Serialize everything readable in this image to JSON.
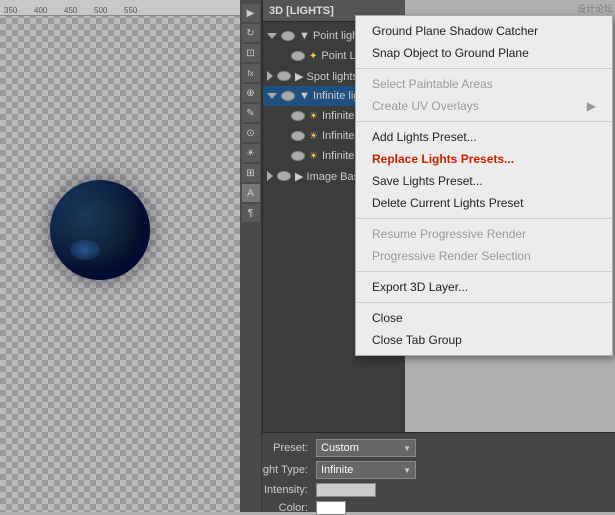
{
  "window": {
    "title": "3D [LIGHTS]"
  },
  "ruler": {
    "marks": [
      "350",
      "400",
      "450",
      "500",
      "550"
    ]
  },
  "panel": {
    "title": "3D [LIGHTS]",
    "sections": [
      {
        "label": "Point lights",
        "items": [
          {
            "label": "Point Li...",
            "indent": true
          }
        ]
      },
      {
        "label": "Spot lights",
        "items": []
      },
      {
        "label": "Infinite light",
        "selected": true,
        "items": [
          {
            "label": "Infinite",
            "indent": true
          },
          {
            "label": "Infinite",
            "indent": true
          },
          {
            "label": "Infinite",
            "indent": true
          }
        ]
      },
      {
        "label": "Image Base...",
        "items": []
      }
    ]
  },
  "preset_bar": {
    "preset_label": "Preset:",
    "preset_value": "Custom",
    "light_type_label": "Light Type:",
    "light_type_value": "Infinite",
    "intensity_label": "Intensity:",
    "color_label": "Color:"
  },
  "context_menu": {
    "items": [
      {
        "label": "Ground Plane Shadow Catcher",
        "disabled": false
      },
      {
        "label": "Snap Object to Ground Plane",
        "disabled": false
      },
      {
        "separator": true
      },
      {
        "label": "Select Paintable Areas",
        "disabled": true
      },
      {
        "label": "Create UV Overlays",
        "disabled": true,
        "has_submenu": true
      },
      {
        "separator": true
      },
      {
        "label": "Add Lights Preset...",
        "disabled": false
      },
      {
        "label": "Replace Lights Presets...",
        "disabled": false,
        "highlighted": true
      },
      {
        "label": "Save Lights Preset...",
        "disabled": false
      },
      {
        "label": "Delete Current Lights Preset",
        "disabled": false
      },
      {
        "separator": true
      },
      {
        "label": "Resume Progressive Render",
        "disabled": true
      },
      {
        "label": "Progressive Render Selection",
        "disabled": true
      },
      {
        "separator": true
      },
      {
        "label": "Export 3D Layer...",
        "disabled": false
      },
      {
        "separator": true
      },
      {
        "label": "Close",
        "disabled": false
      },
      {
        "label": "Close Tab Group",
        "disabled": false
      }
    ]
  },
  "tools": {
    "icons": [
      "▶",
      "⬛",
      "⬜",
      "fx",
      "A",
      "¶",
      "⊕",
      "⊗",
      "⊘",
      "⊙"
    ]
  }
}
